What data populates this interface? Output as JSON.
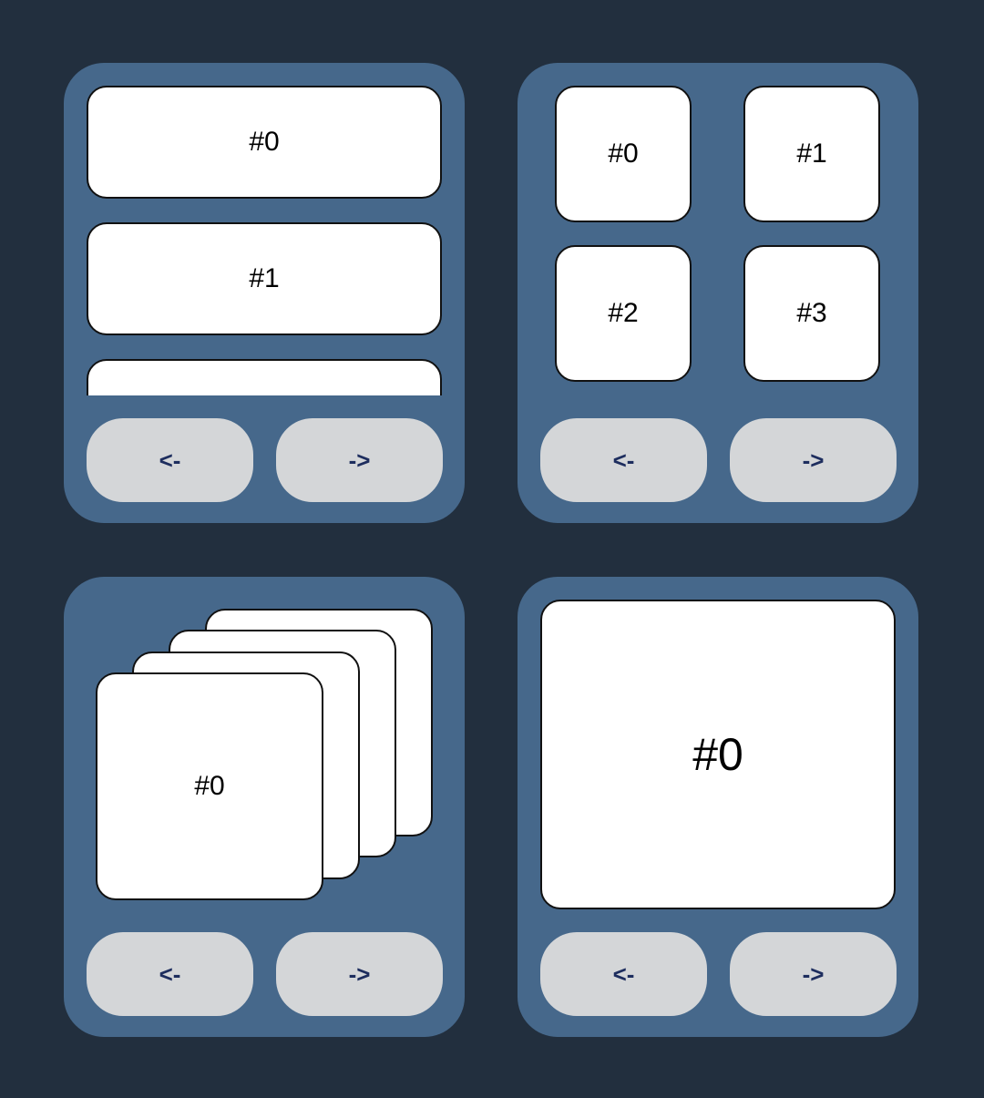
{
  "list_carousel": {
    "items": [
      "#0",
      "#1",
      ""
    ],
    "prev_label": "<-",
    "next_label": "->"
  },
  "grid_carousel": {
    "items": [
      "#0",
      "#1",
      "#2",
      "#3"
    ],
    "prev_label": "<-",
    "next_label": "->"
  },
  "stack_carousel": {
    "top_item": "#0",
    "prev_label": "<-",
    "next_label": "->"
  },
  "single_carousel": {
    "item": "#0",
    "prev_label": "<-",
    "next_label": "->"
  },
  "colors": {
    "background": "#222f3e",
    "panel": "#46688b",
    "card": "#ffffff",
    "button": "#d4d6d8",
    "button_text": "#1d2d5e"
  }
}
